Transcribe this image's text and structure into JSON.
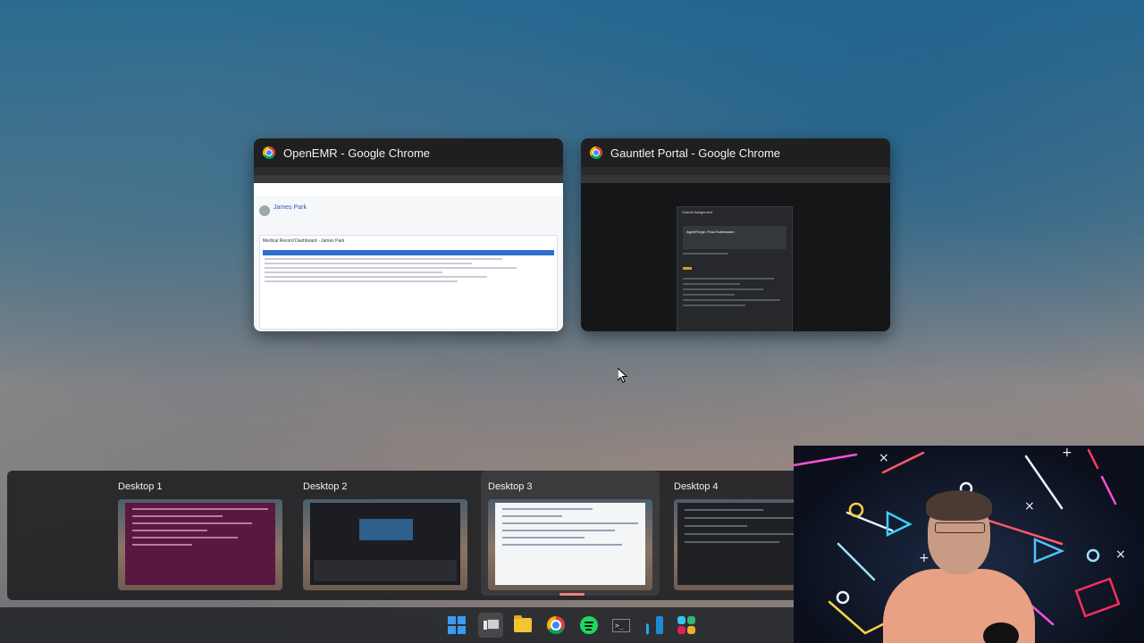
{
  "windows": [
    {
      "title": "OpenEMR - Google Chrome",
      "app_icon": "chrome-icon",
      "preview": {
        "patient_name": "James Park",
        "dashboard_title": "Medical Record Dashboard - James Park"
      }
    },
    {
      "title": "Gauntlet Portal - Google Chrome",
      "app_icon": "chrome-icon",
      "preview": {
        "modal_title": "Submit Assignment",
        "card_title": "AgentForge: Final Submission"
      }
    }
  ],
  "desktops": [
    {
      "label": "Desktop 1"
    },
    {
      "label": "Desktop 2"
    },
    {
      "label": "Desktop 3",
      "active": true
    },
    {
      "label": "Desktop 4"
    }
  ],
  "taskbar": {
    "items": [
      "windows-start-icon",
      "task-view-icon",
      "file-explorer-icon",
      "chrome-icon",
      "spotify-icon",
      "terminal-icon",
      "vscode-icon",
      "slack-icon"
    ],
    "terminal_glyph": ">_"
  },
  "colors": {
    "accent": "#3a9cf0",
    "active_indicator": "#f08080"
  }
}
